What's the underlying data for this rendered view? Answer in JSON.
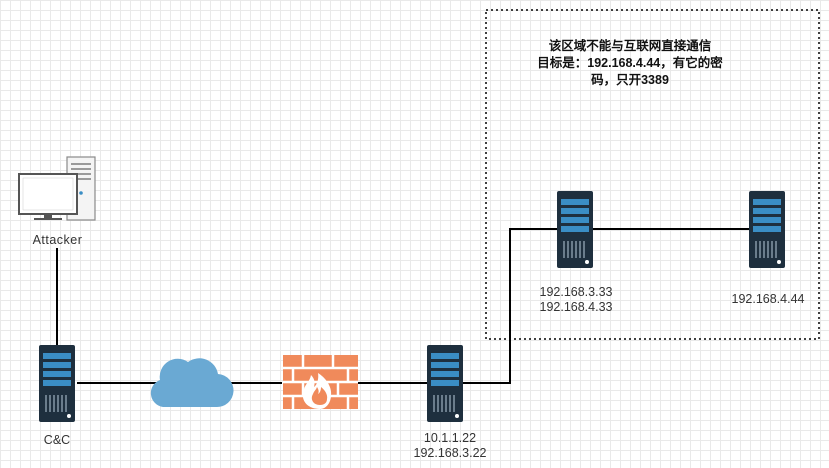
{
  "diagram": {
    "zone_note": {
      "line1": "该区域不能与互联网直接通信",
      "line2": "目标是：192.168.4.44，有它的密",
      "line3": "码，只开3389"
    },
    "nodes": {
      "attacker": {
        "label": "Attacker"
      },
      "cnc": {
        "label": "C&C"
      },
      "gateway": {
        "ip1": "10.1.1.22",
        "ip2": "192.168.3.22"
      },
      "pivot": {
        "ip1": "192.168.3.33",
        "ip2": "192.168.4.33"
      },
      "target": {
        "ip1": "192.168.4.44"
      }
    },
    "colors": {
      "server_body": "#1e2f3e",
      "server_led": "#3a8dc4",
      "cloud": "#6aa9d3",
      "firewall_brick": "#f08a5b",
      "firewall_flame": "#ffffff",
      "line": "#000000"
    }
  }
}
